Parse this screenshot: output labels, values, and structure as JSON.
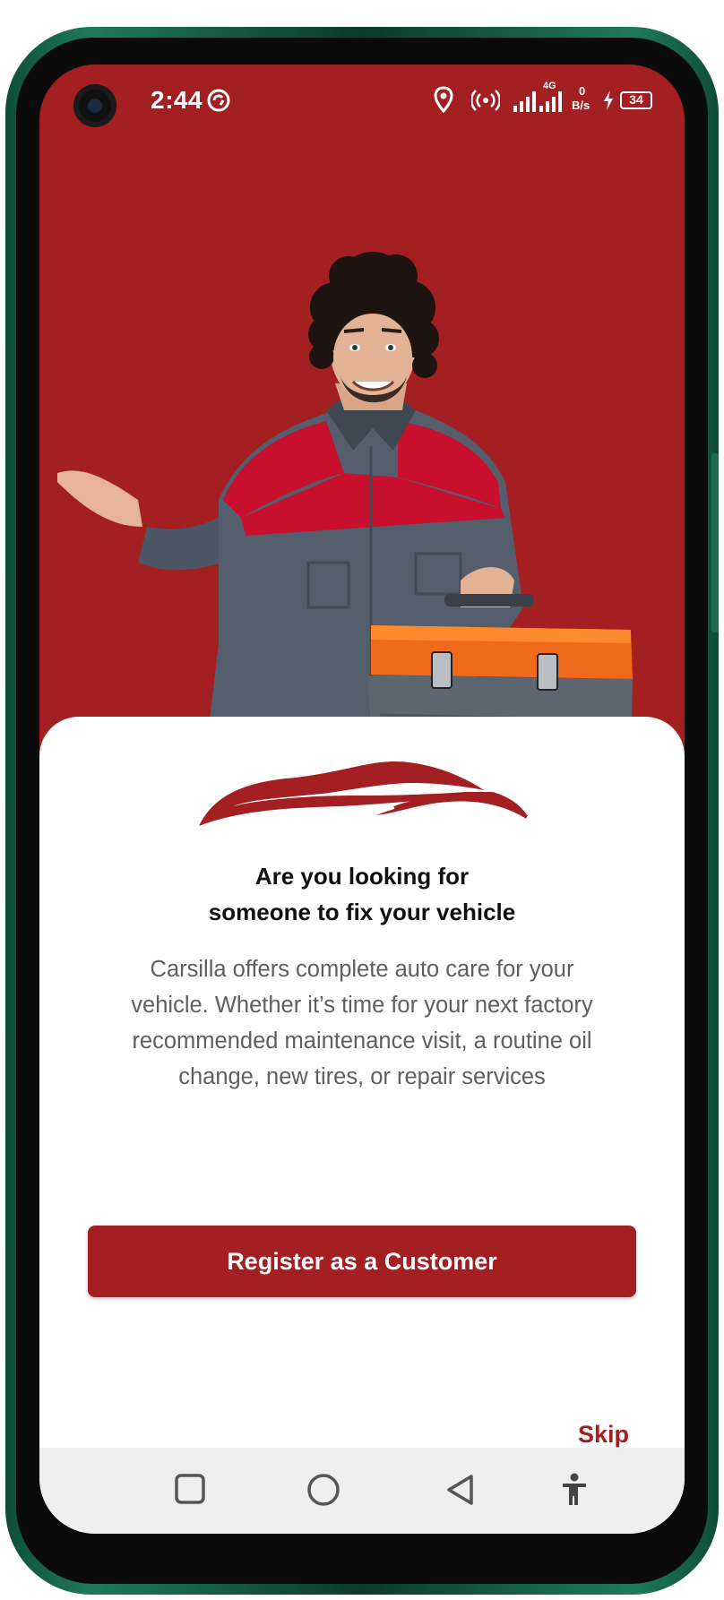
{
  "status_bar": {
    "time": "2:44",
    "network_type": "4G",
    "data_rate_value": "0",
    "data_rate_unit": "B/s",
    "battery": "34"
  },
  "hero": {
    "image": "mechanic-holding-toolbox"
  },
  "onboarding": {
    "logo": "car-silhouette-logo",
    "title_line1": "Are you looking for",
    "title_line2": "someone to fix your vehicle",
    "desc_line1": "Carsilla offers complete auto care for your",
    "desc_line2": "vehicle. Whether it’s time for your next factory",
    "desc_line3": "recommended maintenance visit, a routine oil",
    "desc_line4": "change, new tires, or repair services",
    "register_button": "Register as a Customer",
    "skip": "Skip"
  },
  "nav_bar": {
    "recent_icon": "square-icon",
    "home_icon": "circle-icon",
    "back_icon": "triangle-back-icon",
    "accessibility_icon": "accessibility-icon"
  },
  "colors": {
    "brand": "#a31f21",
    "frame": "#1f7a5c"
  }
}
